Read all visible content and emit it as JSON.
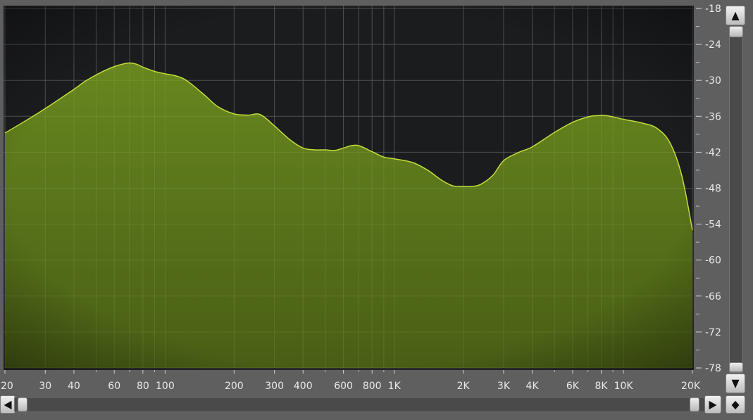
{
  "colors": {
    "background": "#5f5f5f",
    "plot_background": "#1b1c1e",
    "fill_top": "#6a8a1f",
    "fill_bottom": "#4a6015",
    "outline": "#c4dd3a",
    "grid": "#5a5c5e"
  },
  "icons": {
    "scroll_up": "▲",
    "scroll_down": "▼",
    "scroll_left": "◀",
    "scroll_right": "▶",
    "reset": "◆"
  },
  "chart_data": {
    "type": "area",
    "x_scale": "log",
    "xlim": [
      20,
      20000
    ],
    "ylim": [
      -78,
      -18
    ],
    "x_tick_labels": [
      {
        "value": 20,
        "label": "20"
      },
      {
        "value": 30,
        "label": "30"
      },
      {
        "value": 40,
        "label": "40"
      },
      {
        "value": 60,
        "label": "60"
      },
      {
        "value": 80,
        "label": "80"
      },
      {
        "value": 100,
        "label": "100"
      },
      {
        "value": 200,
        "label": "200"
      },
      {
        "value": 300,
        "label": "300"
      },
      {
        "value": 400,
        "label": "400"
      },
      {
        "value": 600,
        "label": "600"
      },
      {
        "value": 800,
        "label": "800"
      },
      {
        "value": 1000,
        "label": "1K"
      },
      {
        "value": 2000,
        "label": "2K"
      },
      {
        "value": 3000,
        "label": "3K"
      },
      {
        "value": 4000,
        "label": "4K"
      },
      {
        "value": 6000,
        "label": "6K"
      },
      {
        "value": 8000,
        "label": "8K"
      },
      {
        "value": 10000,
        "label": "10K"
      },
      {
        "value": 20000,
        "label": "20K"
      }
    ],
    "x_minor_ticks": [
      50,
      70,
      90,
      500,
      700,
      900,
      5000,
      7000,
      9000
    ],
    "y_tick_labels": [
      {
        "value": -18,
        "label": "-18"
      },
      {
        "value": -24,
        "label": "-24"
      },
      {
        "value": -30,
        "label": "-30"
      },
      {
        "value": -36,
        "label": "-36"
      },
      {
        "value": -42,
        "label": "-42"
      },
      {
        "value": -48,
        "label": "-48"
      },
      {
        "value": -54,
        "label": "-54"
      },
      {
        "value": -60,
        "label": "-60"
      },
      {
        "value": -66,
        "label": "-66"
      },
      {
        "value": -72,
        "label": "-72"
      },
      {
        "value": -78,
        "label": "-78"
      }
    ],
    "grid": true,
    "series": [
      {
        "x": [
          20,
          25,
          30,
          35,
          40,
          45,
          50,
          55,
          60,
          65,
          70,
          75,
          80,
          90,
          100,
          110,
          120,
          130,
          150,
          170,
          200,
          230,
          260,
          300,
          350,
          400,
          450,
          500,
          550,
          600,
          650,
          700,
          800,
          900,
          1000,
          1200,
          1400,
          1600,
          1800,
          2000,
          2200,
          2400,
          2700,
          3000,
          3500,
          4000,
          5000,
          6000,
          7000,
          7600,
          8500,
          10000,
          12000,
          14000,
          16000,
          18000,
          20000
        ],
        "y": [
          -38.8,
          -36.6,
          -34.7,
          -33.0,
          -31.5,
          -30.1,
          -29.1,
          -28.3,
          -27.7,
          -27.3,
          -27.1,
          -27.3,
          -27.8,
          -28.5,
          -28.9,
          -29.2,
          -29.7,
          -30.6,
          -32.6,
          -34.4,
          -35.6,
          -35.8,
          -35.7,
          -37.6,
          -39.9,
          -41.3,
          -41.6,
          -41.6,
          -41.7,
          -41.3,
          -40.9,
          -40.9,
          -41.9,
          -42.8,
          -43.1,
          -43.7,
          -45.0,
          -46.6,
          -47.6,
          -47.7,
          -47.7,
          -47.3,
          -45.8,
          -43.4,
          -42.0,
          -41.1,
          -38.7,
          -37.0,
          -36.1,
          -35.9,
          -35.9,
          -36.5,
          -37.1,
          -38.0,
          -40.5,
          -46.0,
          -55.0
        ]
      }
    ]
  }
}
